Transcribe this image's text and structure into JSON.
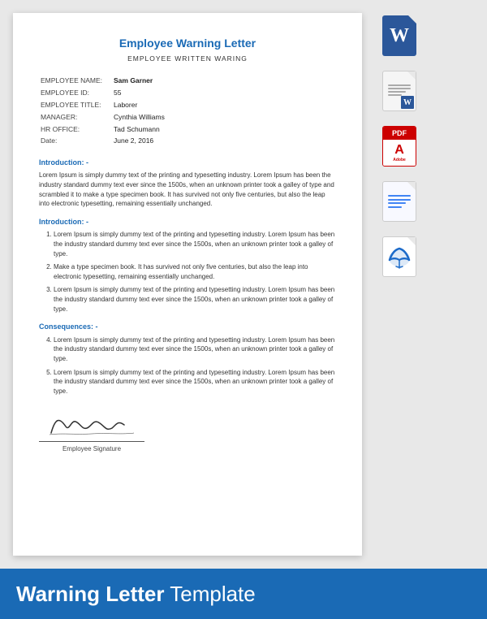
{
  "document": {
    "title": "Employee Warning Letter",
    "subtitle": "EMPLOYEE WRITTEN WARING",
    "fields": [
      {
        "label": "EMPLOYEE NAME:",
        "value": "Sam Garner",
        "bold": true
      },
      {
        "label": "EMPLOYEE ID:",
        "value": "55",
        "bold": false
      },
      {
        "label": "EMPLOYEE TITLE:",
        "value": "Laborer",
        "bold": false
      },
      {
        "label": "MANAGER:",
        "value": "Cynthia Williams",
        "bold": false
      },
      {
        "label": "HR OFFICE:",
        "value": "Tad Schumann",
        "bold": false
      },
      {
        "label": "Date:",
        "value": "June 2, 2016",
        "bold": false
      }
    ],
    "section1": {
      "heading": "Introduction: -",
      "body": "Lorem Ipsum is simply dummy text of the printing and typesetting industry. Lorem Ipsum has been the industry standard dummy text ever since the 1500s, when an unknown printer took a galley of type and scrambled it to make a type specimen book. It has survived not only five centuries, but also the leap into electronic typesetting, remaining essentially unchanged."
    },
    "section2": {
      "heading": "Introduction: -",
      "items": [
        "Lorem Ipsum is simply dummy text of the printing and typesetting industry. Lorem Ipsum has been the industry standard dummy text ever since the 1500s, when an unknown printer took a galley of type.",
        "Make a type specimen book. It has survived not only five centuries, but also the leap into electronic typesetting, remaining essentially unchanged.",
        "Lorem Ipsum is simply dummy text of the printing and typesetting industry. Lorem Ipsum has been the industry standard dummy text ever since the 1500s, when an unknown printer took a galley of type."
      ],
      "start": 1
    },
    "section3": {
      "heading": "Consequences: -",
      "items": [
        "Lorem Ipsum is simply dummy text of the printing and typesetting industry. Lorem Ipsum has been the industry standard dummy text ever since the 1500s, when an unknown printer took a galley of type.",
        "Lorem Ipsum is simply dummy text of the printing and typesetting industry. Lorem Ipsum has been the industry standard dummy text ever since the 1500s, when an unknown printer took a galley of type."
      ],
      "start": 4
    },
    "signature_label": "Employee Signature"
  },
  "sidebar": {
    "icons": [
      {
        "id": "word-blue",
        "type": "word-blue",
        "label": "Word Blue"
      },
      {
        "id": "word-doc",
        "type": "word-doc",
        "label": "Word Doc"
      },
      {
        "id": "pdf",
        "type": "pdf",
        "label": "PDF Adobe"
      },
      {
        "id": "google-docs",
        "type": "google-docs",
        "label": "Google Docs"
      },
      {
        "id": "libreoffice",
        "type": "libreoffice",
        "label": "LibreOffice Writer"
      }
    ]
  },
  "bottom": {
    "text_bold": "Warning Letter",
    "text_normal": " Template"
  }
}
